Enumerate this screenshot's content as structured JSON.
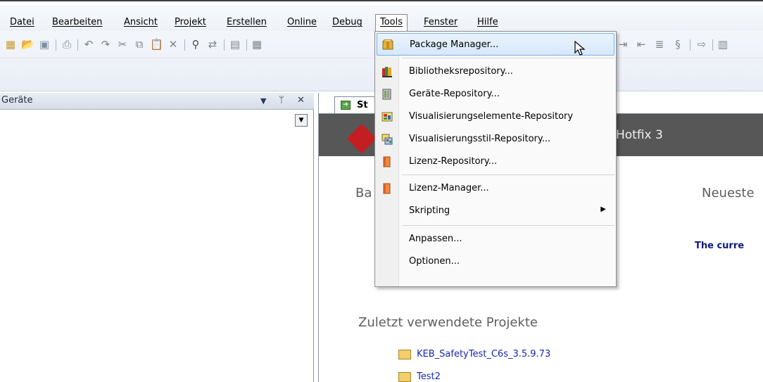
{
  "menubar": {
    "items": [
      "Datei",
      "Bearbeiten",
      "Ansicht",
      "Projekt",
      "Erstellen",
      "Online",
      "Debug",
      "Tools",
      "Fenster",
      "Hilfe"
    ],
    "active": "Tools"
  },
  "left_pane": {
    "title": "Geräte",
    "pin_glyph": "ᛘ",
    "close_glyph": "✕",
    "menu_glyph": "▾"
  },
  "document": {
    "tab_label": "St",
    "banner_text": "Hotfix 3",
    "section_left": "Ba",
    "section_right": "Neueste",
    "news_text": "The curre",
    "recent_title": "Zuletzt verwendete Projekte",
    "recent_projects": [
      "KEB_SafetyTest_C6s_3.5.9.73",
      "Test2"
    ]
  },
  "tools_menu": {
    "items": [
      {
        "label": "Package Manager...",
        "icon": "package-icon",
        "hover": true
      },
      {
        "label": "Bibliotheksrepository...",
        "icon": "library-repository-icon"
      },
      {
        "label": "Geräte-Repository...",
        "icon": "device-repository-icon"
      },
      {
        "label": "Visualisierungselemente-Repository",
        "icon": "visualization-elements-icon"
      },
      {
        "label": "Visualisierungsstil-Repository...",
        "icon": "visualization-style-icon"
      },
      {
        "label": "Lizenz-Repository...",
        "icon": "license-repository-icon"
      },
      {
        "label": "Lizenz-Manager...",
        "icon": "license-manager-icon"
      },
      {
        "label": "Skripting",
        "icon": "",
        "submenu": true
      },
      {
        "label": "Anpassen...",
        "icon": ""
      },
      {
        "label": "Optionen...",
        "icon": ""
      }
    ]
  },
  "colors": {
    "banner": "#575757",
    "link": "#1428ad",
    "hover_border": "#7ab0e6"
  }
}
